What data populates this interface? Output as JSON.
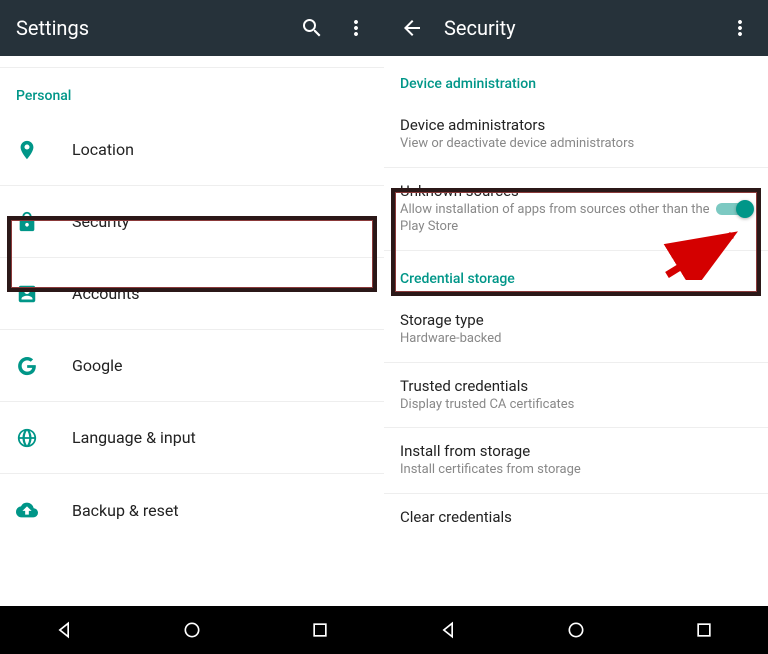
{
  "left": {
    "title": "Settings",
    "section": "Personal",
    "items": [
      {
        "label": "Location"
      },
      {
        "label": "Security"
      },
      {
        "label": "Accounts"
      },
      {
        "label": "Google"
      },
      {
        "label": "Language & input"
      },
      {
        "label": "Backup & reset"
      }
    ]
  },
  "right": {
    "title": "Security",
    "section_admin": "Device administration",
    "device_admin": {
      "title": "Device administrators",
      "sub": "View or deactivate device administrators"
    },
    "unknown_sources": {
      "title": "Unknown sources",
      "sub": "Allow installation of apps from sources other than the Play Store"
    },
    "section_cred": "Credential storage",
    "storage_type": {
      "title": "Storage type",
      "sub": "Hardware-backed"
    },
    "trusted": {
      "title": "Trusted credentials",
      "sub": "Display trusted CA certificates"
    },
    "install": {
      "title": "Install from storage",
      "sub": "Install certificates from storage"
    },
    "clear": {
      "title": "Clear credentials"
    }
  }
}
